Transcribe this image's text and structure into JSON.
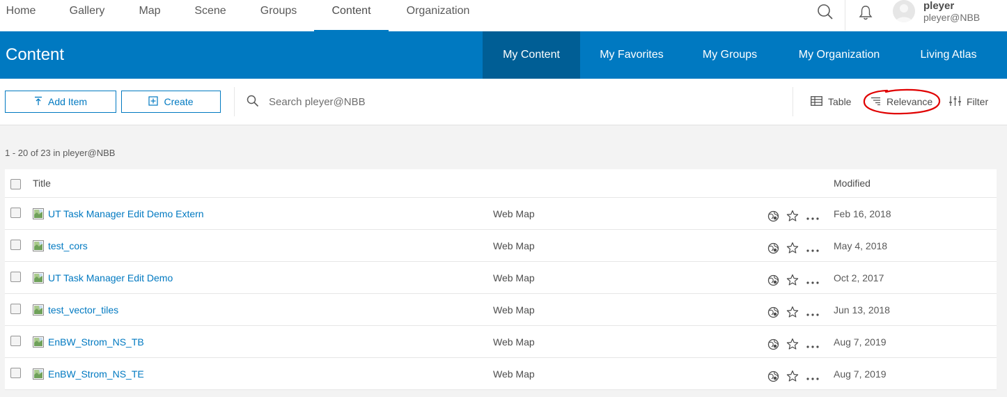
{
  "topnav": {
    "items": [
      {
        "label": "Home"
      },
      {
        "label": "Gallery"
      },
      {
        "label": "Map"
      },
      {
        "label": "Scene"
      },
      {
        "label": "Groups"
      },
      {
        "label": "Content",
        "active": true
      },
      {
        "label": "Organization"
      }
    ],
    "user": {
      "name": "pleyer",
      "org": "pleyer@NBB"
    },
    "icons": {
      "search": "search-icon",
      "notifications": "bell-icon",
      "avatar": "user-avatar-icon"
    }
  },
  "header": {
    "title": "Content",
    "tabs": [
      {
        "label": "My Content",
        "active": true
      },
      {
        "label": "My Favorites"
      },
      {
        "label": "My Groups"
      },
      {
        "label": "My Organization"
      },
      {
        "label": "Living Atlas"
      }
    ],
    "colors": {
      "background": "#0079c1",
      "active_tab": "#005e95"
    }
  },
  "toolbar": {
    "add_item_label": "Add Item",
    "create_label": "Create",
    "search_placeholder": "Search pleyer@NBB",
    "table_label": "Table",
    "relevance_label": "Relevance",
    "filter_label": "Filter"
  },
  "annotation": {
    "color": "#e00000",
    "target": "Relevance"
  },
  "results": {
    "count_text": "1 - 20 of 23 in pleyer@NBB",
    "columns": {
      "title": "Title",
      "modified": "Modified"
    },
    "rows": [
      {
        "title": "UT Task Manager Edit Demo Extern",
        "type": "Web Map",
        "modified": "Feb 16, 2018"
      },
      {
        "title": "test_cors",
        "type": "Web Map",
        "modified": "May 4, 2018"
      },
      {
        "title": "UT Task Manager Edit Demo",
        "type": "Web Map",
        "modified": "Oct 2, 2017"
      },
      {
        "title": "test_vector_tiles",
        "type": "Web Map",
        "modified": "Jun 13, 2018"
      },
      {
        "title": "EnBW_Strom_NS_TB",
        "type": "Web Map",
        "modified": "Aug 7, 2019"
      },
      {
        "title": "EnBW_Strom_NS_TE",
        "type": "Web Map",
        "modified": "Aug 7, 2019"
      }
    ]
  }
}
